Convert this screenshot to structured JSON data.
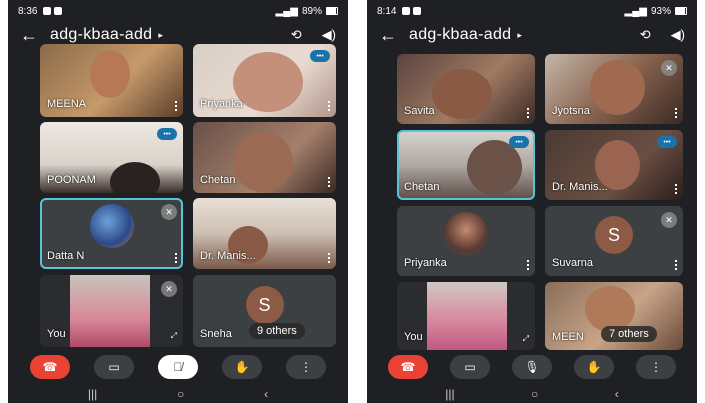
{
  "left_phone": {
    "status": {
      "time": "8:36",
      "battery": "89%",
      "battery_level": 0.89
    },
    "meeting_title": "adg-kbaa-add",
    "tiles": [
      {
        "name": "MEENA"
      },
      {
        "name": "Priyanka"
      },
      {
        "name": "POONAM"
      },
      {
        "name": "Chetan"
      },
      {
        "name": "Datta N"
      },
      {
        "name": "Dr. Manis..."
      },
      {
        "name": "You"
      },
      {
        "name": "Sneha",
        "avatar_letter": "S",
        "others_label": "9 others"
      }
    ]
  },
  "right_phone": {
    "status": {
      "time": "8:14",
      "battery": "93%",
      "battery_level": 0.93
    },
    "meeting_title": "adg-kbaa-add",
    "tiles": [
      {
        "name": "Savita"
      },
      {
        "name": "Jyotsna"
      },
      {
        "name": "Chetan"
      },
      {
        "name": "Dr. Manis..."
      },
      {
        "name": "Priyanka"
      },
      {
        "name": "Suvarna",
        "avatar_letter": "S"
      },
      {
        "name": "You"
      },
      {
        "name": "MEEN",
        "others_label": "7 others"
      }
    ]
  },
  "icons": {
    "back": "←",
    "caret": "▸",
    "end_call": "☎",
    "camera": "▭",
    "mic": "🎙",
    "hand": "✋",
    "more": "⋮",
    "nav_recents": "|||",
    "nav_home": "○",
    "nav_back": "‹"
  },
  "colors": {
    "end_call": "#ea4335",
    "active_outline": "#58c5d6",
    "talking_badge": "#1a73a8",
    "avatar_bg": "#8d5a45"
  }
}
